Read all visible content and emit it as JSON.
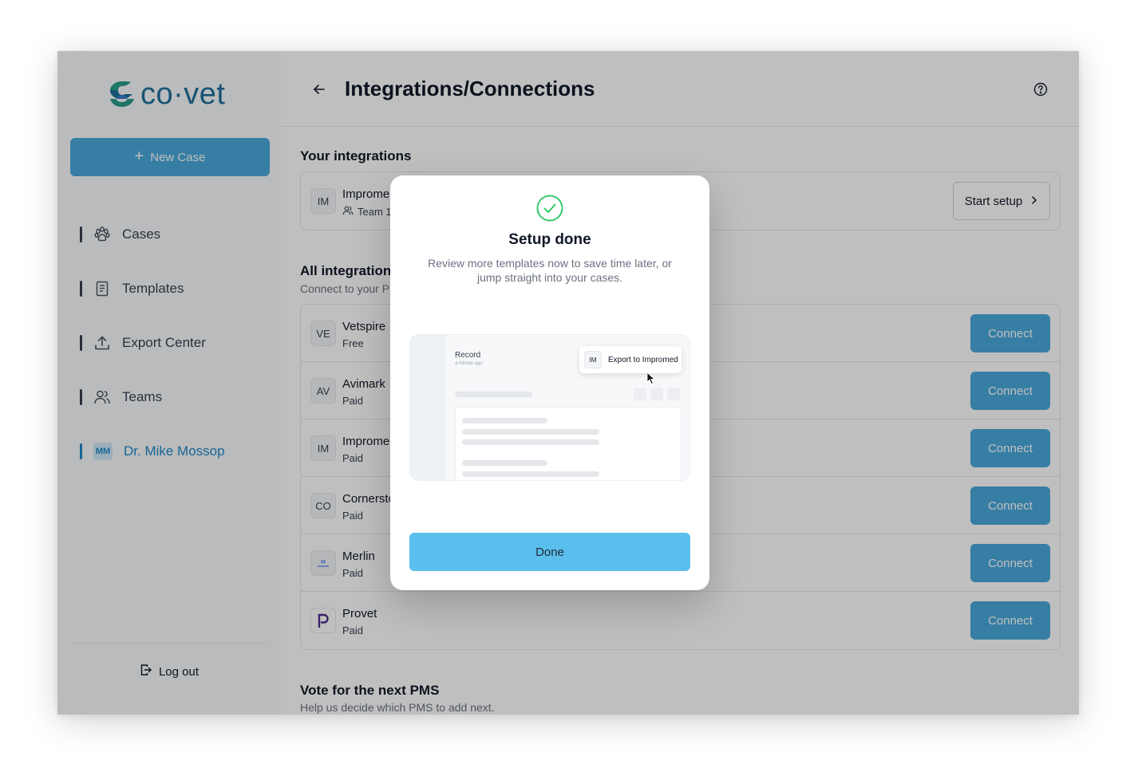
{
  "app": {
    "logo_text": "co·vet"
  },
  "sidebar": {
    "new_case_label": "New Case",
    "items": [
      {
        "label": "Cases",
        "icon": "paw-icon"
      },
      {
        "label": "Templates",
        "icon": "document-icon"
      },
      {
        "label": "Export Center",
        "icon": "upload-icon"
      },
      {
        "label": "Teams",
        "icon": "users-icon"
      },
      {
        "label": "Dr. Mike Mossop",
        "avatar": "MM",
        "active": true
      }
    ],
    "logout_label": "Log out"
  },
  "header": {
    "title": "Integrations/Connections"
  },
  "your_integrations": {
    "title": "Your integrations",
    "items": [
      {
        "badge": "IM",
        "name": "Improme",
        "team": "Team 1",
        "action": "Start setup"
      }
    ]
  },
  "all_integrations": {
    "title": "All integrations",
    "subtitle": "Connect to your P",
    "connect_label": "Connect",
    "items": [
      {
        "badge": "VE",
        "name": "Vetspire",
        "tier": "Free"
      },
      {
        "badge": "AV",
        "name": "Avimark",
        "tier": "Paid"
      },
      {
        "badge": "IM",
        "name": "Improme",
        "tier": "Paid"
      },
      {
        "badge": "CO",
        "name": "Cornersto",
        "tier": "Paid"
      },
      {
        "badge": "logo",
        "name": "Merlin",
        "tier": "Paid"
      },
      {
        "badge": "logo",
        "name": "Provet",
        "tier": "Paid"
      }
    ]
  },
  "vote": {
    "title": "Vote for the next PMS",
    "subtitle": "Help us decide which PMS to add next."
  },
  "modal": {
    "title": "Setup done",
    "description": "Review more templates now to save time later, or jump straight into your cases.",
    "preview": {
      "record_label": "Record",
      "record_time": "a minute ago",
      "export_badge": "IM",
      "export_label": "Export to Impromed"
    },
    "done_label": "Done"
  },
  "colors": {
    "brand_blue": "#4aa9db",
    "active_blue": "#1e88c7",
    "done_blue": "#5bbfed",
    "success_green": "#22c55e",
    "provet_purple": "#4b2a8c"
  }
}
